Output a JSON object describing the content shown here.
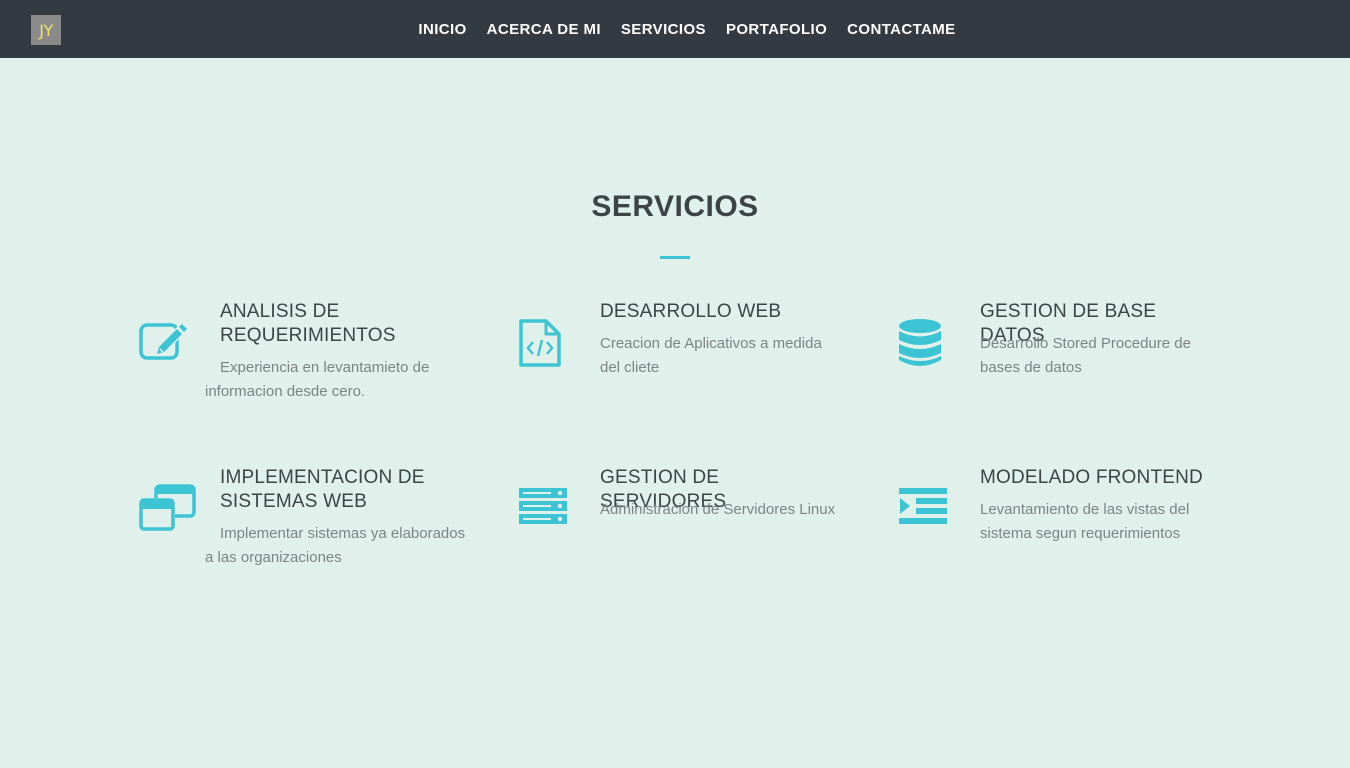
{
  "nav": {
    "logo": "JY",
    "links": [
      "INICIO",
      "ACERCA DE MI",
      "SERVICIOS",
      "PORTAFOLIO",
      "CONTACTAME"
    ]
  },
  "section": {
    "title": "SERVICIOS",
    "services": [
      {
        "title": "ANALISIS DE REQUERIMIENTOS",
        "desc": "Experiencia en levantamieto de informacion desde cero.",
        "icon": "edit-icon"
      },
      {
        "title": "DESARROLLO WEB",
        "desc": "Creacion de Aplicativos a medida del cliete",
        "icon": "code-file-icon"
      },
      {
        "title": "GESTION DE BASE DATOS",
        "desc": "Desarrollo Stored Procedure de bases de datos",
        "icon": "database-icon"
      },
      {
        "title": "IMPLEMENTACION DE SISTEMAS WEB",
        "desc": "Implementar sistemas ya elaborados a las organizaciones",
        "icon": "windows-icon"
      },
      {
        "title": "GESTION DE SERVIDORES",
        "desc": "Administracion de Servidores Linux",
        "icon": "server-icon"
      },
      {
        "title": "MODELADO FRONTEND",
        "desc": "Levantamiento de las vistas del sistema segun requerimientos",
        "icon": "indent-icon"
      }
    ]
  },
  "colors": {
    "navbar": "#343a42",
    "background": "#e0f0ea",
    "accent": "#3cc4d4",
    "logo_text": "#f2e46a"
  }
}
